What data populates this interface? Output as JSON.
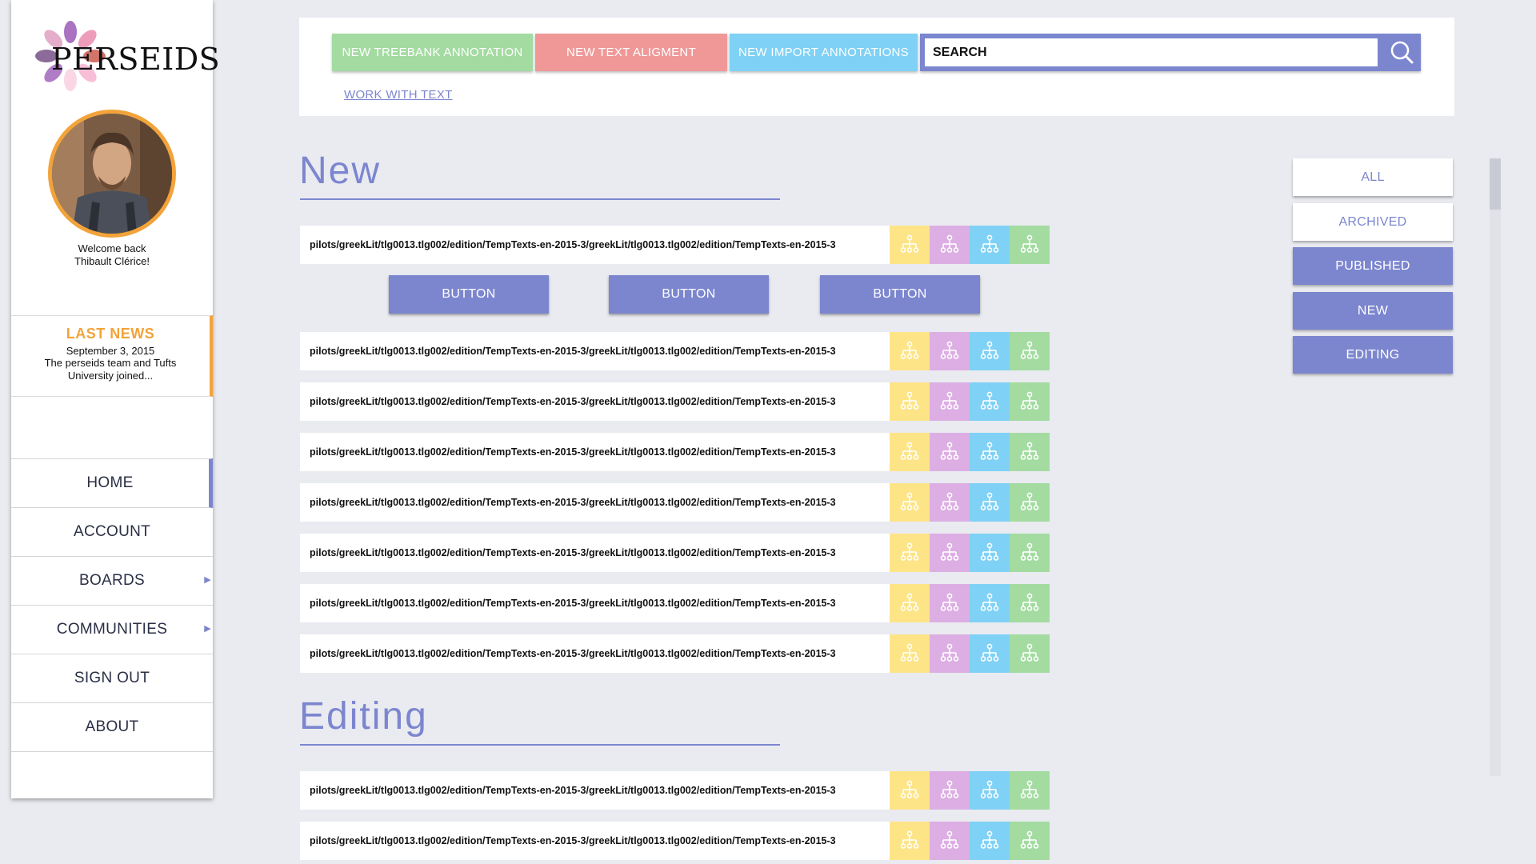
{
  "colors": {
    "accent": "#7c86cf",
    "orange": "#f2a33a",
    "green_button": "#a3dba1",
    "red_button": "#f09898",
    "blue_button": "#7fd1f5",
    "tree_yellow": "#fde487",
    "tree_purple": "#dcaee3",
    "tree_blue": "#7fd1f5",
    "tree_green": "#a3dba1"
  },
  "sidebar": {
    "logo_text": "PERSEIDS",
    "welcome_line1": "Welcome back",
    "welcome_line2": "Thibault Clérice!",
    "news": {
      "title": "LAST NEWS",
      "date": "September 3, 2015",
      "body": "The perseids team and Tufts University joined..."
    },
    "nav": [
      {
        "label": "HOME",
        "active": true,
        "submenu": false
      },
      {
        "label": "ACCOUNT",
        "active": false,
        "submenu": false
      },
      {
        "label": "BOARDS",
        "active": false,
        "submenu": true
      },
      {
        "label": "COMMUNITIES",
        "active": false,
        "submenu": true
      },
      {
        "label": "SIGN OUT",
        "active": false,
        "submenu": false
      },
      {
        "label": "ABOUT",
        "active": false,
        "submenu": false
      }
    ]
  },
  "toolbar": {
    "new_treebank": "NEW TREEBANK ANNOTATION",
    "new_text_alignment": "NEW TEXT ALIGMENT",
    "new_import": "NEW IMPORT ANNOTATIONS",
    "search_value": "SEARCH",
    "search_icon": "search-icon",
    "work_with_text": "WORK WITH TEXT"
  },
  "sections": {
    "new_title": "New",
    "editing_title": "Editing"
  },
  "row_path": "pilots/greekLit/tlg0013.tlg002/edition/TempTexts-en-2015-3/greekLit/tlg0013.tlg002/edition/TempTexts-en-2015-3",
  "new_rows": [
    "pilots/greekLit/tlg0013.tlg002/edition/TempTexts-en-2015-3/greekLit/tlg0013.tlg002/edition/TempTexts-en-2015-3",
    "pilots/greekLit/tlg0013.tlg002/edition/TempTexts-en-2015-3/greekLit/tlg0013.tlg002/edition/TempTexts-en-2015-3",
    "pilots/greekLit/tlg0013.tlg002/edition/TempTexts-en-2015-3/greekLit/tlg0013.tlg002/edition/TempTexts-en-2015-3",
    "pilots/greekLit/tlg0013.tlg002/edition/TempTexts-en-2015-3/greekLit/tlg0013.tlg002/edition/TempTexts-en-2015-3",
    "pilots/greekLit/tlg0013.tlg002/edition/TempTexts-en-2015-3/greekLit/tlg0013.tlg002/edition/TempTexts-en-2015-3",
    "pilots/greekLit/tlg0013.tlg002/edition/TempTexts-en-2015-3/greekLit/tlg0013.tlg002/edition/TempTexts-en-2015-3",
    "pilots/greekLit/tlg0013.tlg002/edition/TempTexts-en-2015-3/greekLit/tlg0013.tlg002/edition/TempTexts-en-2015-3",
    "pilots/greekLit/tlg0013.tlg002/edition/TempTexts-en-2015-3/greekLit/tlg0013.tlg002/edition/TempTexts-en-2015-3"
  ],
  "editing_rows": [
    "pilots/greekLit/tlg0013.tlg002/edition/TempTexts-en-2015-3/greekLit/tlg0013.tlg002/edition/TempTexts-en-2015-3",
    "pilots/greekLit/tlg0013.tlg002/edition/TempTexts-en-2015-3/greekLit/tlg0013.tlg002/edition/TempTexts-en-2015-3"
  ],
  "row_buttons": [
    "BUTTON",
    "BUTTON",
    "BUTTON"
  ],
  "tree_icon": "tree-structure-icon",
  "filters": [
    {
      "label": "ALL",
      "style": "light"
    },
    {
      "label": "ARCHIVED",
      "style": "light"
    },
    {
      "label": "PUBLISHED",
      "style": "dark"
    },
    {
      "label": "NEW",
      "style": "dark"
    },
    {
      "label": "EDITING",
      "style": "dark"
    }
  ]
}
